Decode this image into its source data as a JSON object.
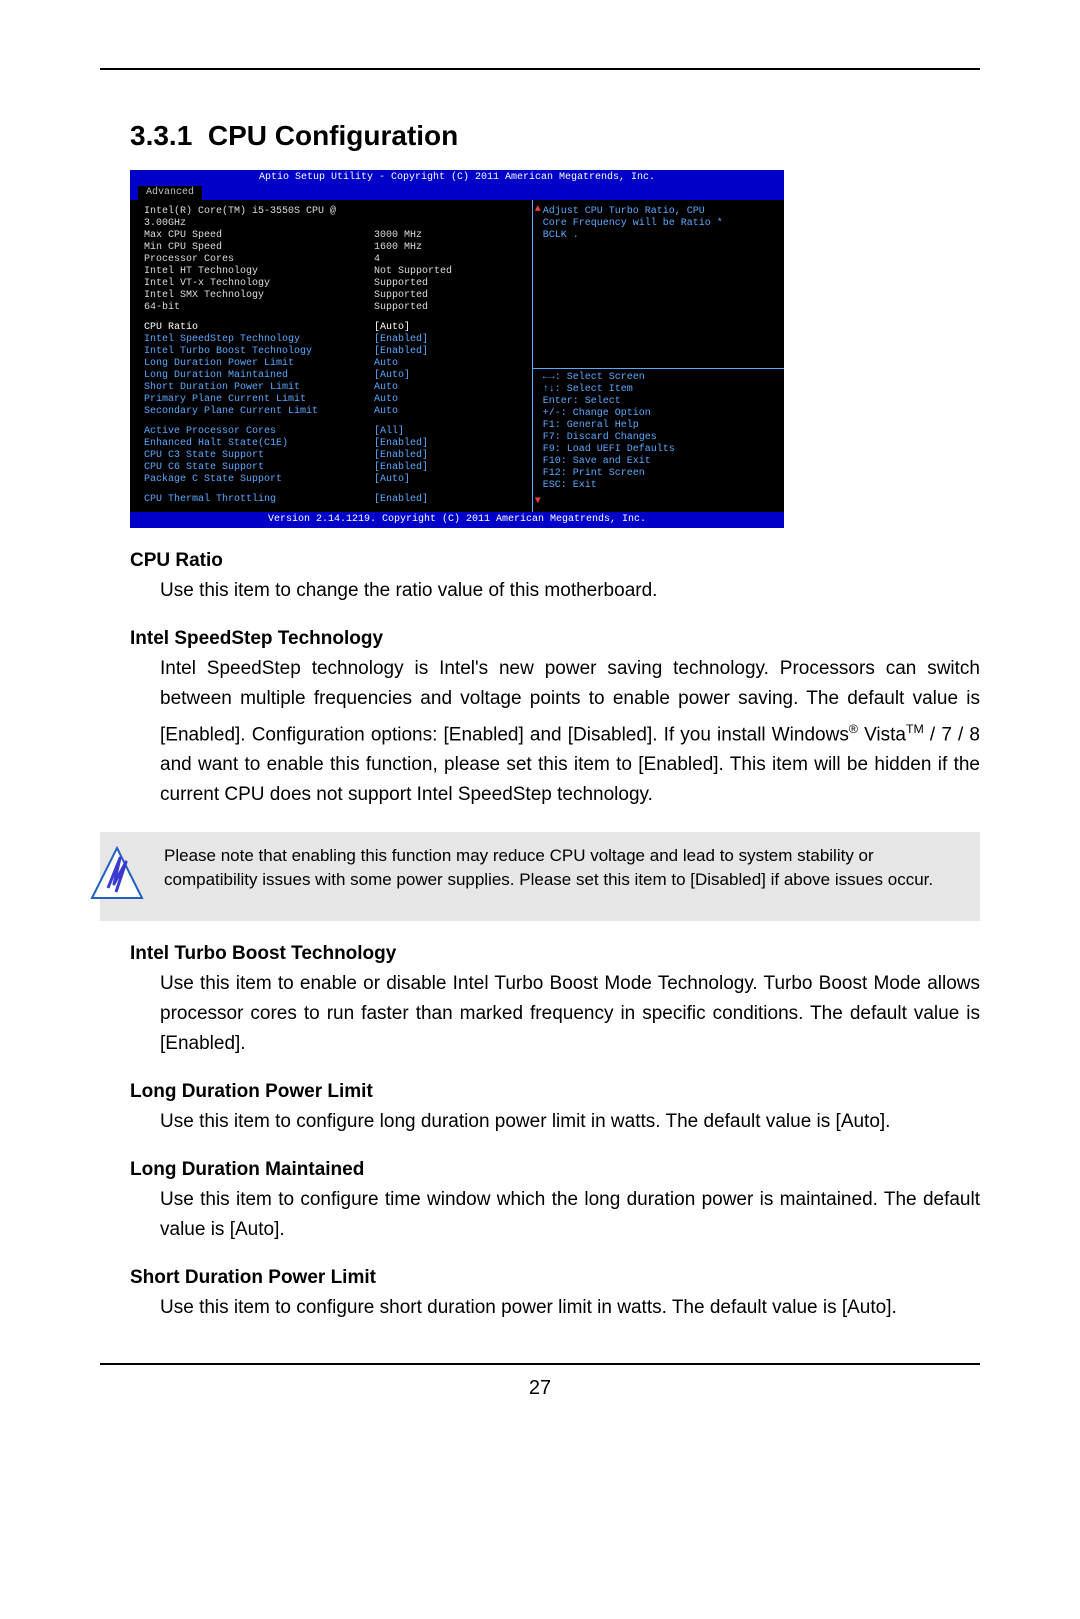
{
  "page_number": "27",
  "section": {
    "number": "3.3.1",
    "title": "CPU Configuration"
  },
  "bios": {
    "title": "Aptio Setup Utility - Copyright (C) 2011 American Megatrends, Inc.",
    "tab": "Advanced",
    "cpu_name": "Intel(R) Core(TM) i5-3550S CPU @ 3.00GHz",
    "info_rows": [
      {
        "k": "Max CPU Speed",
        "v": "3000 MHz"
      },
      {
        "k": "Min CPU Speed",
        "v": "1600 MHz"
      },
      {
        "k": "Processor Cores",
        "v": "4"
      },
      {
        "k": "Intel HT Technology",
        "v": "Not Supported"
      },
      {
        "k": "Intel VT-x Technology",
        "v": "Supported"
      },
      {
        "k": "Intel SMX Technology",
        "v": "Supported"
      },
      {
        "k": "64-bit",
        "v": "Supported"
      }
    ],
    "opt_rows": [
      {
        "k": "CPU Ratio",
        "v": "[Auto]",
        "selected": true
      },
      {
        "k": "Intel SpeedStep Technology",
        "v": "[Enabled]"
      },
      {
        "k": "Intel Turbo Boost Technology",
        "v": "[Enabled]"
      },
      {
        "k": "Long Duration Power Limit",
        "v": "Auto"
      },
      {
        "k": "Long Duration Maintained",
        "v": "[Auto]"
      },
      {
        "k": "Short Duration Power Limit",
        "v": "Auto"
      },
      {
        "k": "Primary Plane Current Limit",
        "v": "Auto"
      },
      {
        "k": "Secondary Plane Current Limit",
        "v": "Auto"
      }
    ],
    "opt_rows2": [
      {
        "k": "Active Processor Cores",
        "v": "[All]"
      },
      {
        "k": "Enhanced Halt State(C1E)",
        "v": "[Enabled]"
      },
      {
        "k": "CPU C3 State Support",
        "v": "[Enabled]"
      },
      {
        "k": "CPU C6 State Support",
        "v": "[Enabled]"
      },
      {
        "k": "Package C State Support",
        "v": "[Auto]"
      }
    ],
    "opt_rows3": [
      {
        "k": "CPU Thermal Throttling",
        "v": "[Enabled]"
      }
    ],
    "help_top": [
      "Adjust CPU Turbo Ratio, CPU",
      "Core Frequency will be Ratio *",
      "BCLK ."
    ],
    "help_keys": [
      "←→: Select Screen",
      "↑↓: Select Item",
      "Enter: Select",
      "+/-: Change Option",
      "F1: General Help",
      "F7: Discard Changes",
      "F9: Load UEFI Defaults",
      "F10: Save and Exit",
      "F12: Print Screen",
      "ESC: Exit"
    ],
    "footer": "Version 2.14.1219. Copyright (C) 2011 American Megatrends, Inc."
  },
  "items": [
    {
      "title": "CPU Ratio",
      "body": "Use this item to change the ratio value of this motherboard.",
      "justify": false
    },
    {
      "title": "Intel SpeedStep Technology",
      "body": "Intel SpeedStep technology is Intel's new power saving technology. Processors can switch between multiple frequencies and voltage points to enable power saving. The default value is [Enabled]. Configuration options: [Enabled] and [Disabled]. If you install Windows® Vista™ / 7 / 8 and want to enable this function, please set this item to [Enabled]. This item will be hidden if the current CPU does not support Intel SpeedStep technology.",
      "justify": true
    }
  ],
  "note": "Please note that enabling this function may reduce CPU voltage and lead to system stability or compatibility issues with some power supplies. Please set this item to [Disabled] if above issues occur.",
  "items2": [
    {
      "title": "Intel Turbo Boost Technology",
      "body": "Use this item to enable or disable Intel Turbo Boost Mode Technology. Turbo Boost Mode allows processor cores to run faster than marked frequency in specific conditions. The default value is [Enabled].",
      "justify": true
    },
    {
      "title": "Long Duration Power Limit",
      "body": "Use this item to configure long duration power limit in watts. The default value is [Auto].",
      "justify": true
    },
    {
      "title": "Long Duration Maintained",
      "body": "Use this item to configure time window which the long duration power is maintained. The default value is [Auto].",
      "justify": true
    },
    {
      "title": "Short Duration Power Limit",
      "body": "Use this item to configure short duration power limit in watts. The default value is [Auto].",
      "justify": true
    }
  ]
}
